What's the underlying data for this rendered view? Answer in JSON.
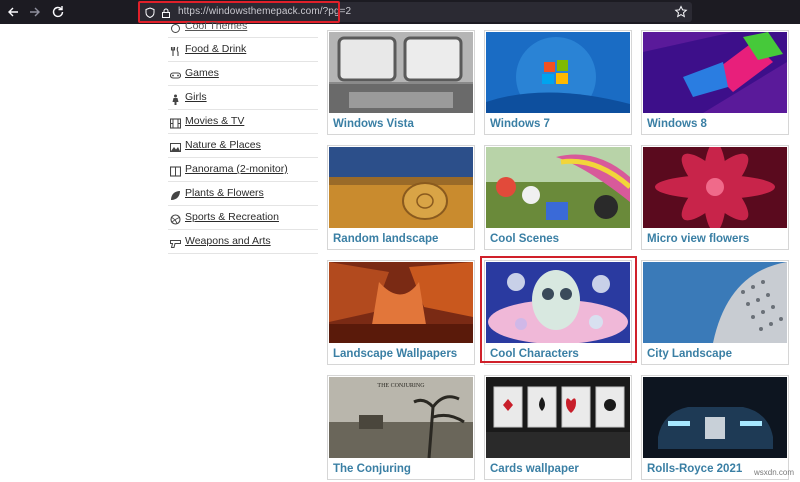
{
  "browser": {
    "url": "https://windowsthemepack.com/?pg=2",
    "icons": {
      "back": "back-arrow-icon",
      "forward": "forward-arrow-icon",
      "reload": "reload-icon",
      "shield": "shield-icon",
      "lock": "lock-icon",
      "bookmark": "bookmark-star-icon"
    },
    "highlight_color": "#e0202a"
  },
  "sidebar": {
    "items": [
      {
        "label": "Cool Themes",
        "icon": "cool-icon"
      },
      {
        "label": "Food & Drink",
        "icon": "fork-knife-icon"
      },
      {
        "label": "Games",
        "icon": "gamepad-icon"
      },
      {
        "label": "Girls",
        "icon": "person-icon"
      },
      {
        "label": "Movies & TV",
        "icon": "film-icon"
      },
      {
        "label": "Nature & Places",
        "icon": "landscape-icon"
      },
      {
        "label": "Panorama (2-monitor)",
        "icon": "dual-monitor-icon"
      },
      {
        "label": "Plants & Flowers",
        "icon": "leaf-icon"
      },
      {
        "label": "Sports & Recreation",
        "icon": "ball-icon"
      },
      {
        "label": "Weapons and Arts",
        "icon": "gun-icon"
      }
    ]
  },
  "tiles": [
    {
      "title": "Windows Vista"
    },
    {
      "title": "Windows 7"
    },
    {
      "title": "Windows 8"
    },
    {
      "title": "Random landscape"
    },
    {
      "title": "Cool Scenes"
    },
    {
      "title": "Micro view flowers"
    },
    {
      "title": "Landscape Wallpapers"
    },
    {
      "title": "Cool Characters"
    },
    {
      "title": "City Landscape"
    },
    {
      "title": "The Conjuring"
    },
    {
      "title": "Cards wallpaper"
    },
    {
      "title": "Rolls-Royce 2021"
    }
  ],
  "thumb_texts": {
    "conjuring_poster": "THE CONJURING"
  },
  "watermark": "wsxdn.com",
  "colors": {
    "tile_title": "#3a7fa4",
    "toolbar_bg": "#1c1b22",
    "highlight": "#d0202a"
  }
}
